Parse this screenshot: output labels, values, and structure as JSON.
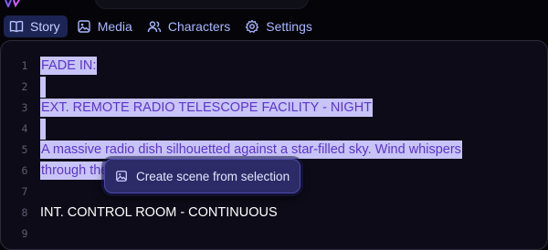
{
  "tabs": [
    {
      "label": "Story",
      "icon": "book-open-icon",
      "active": true
    },
    {
      "label": "Media",
      "icon": "image-icon",
      "active": false
    },
    {
      "label": "Characters",
      "icon": "users-icon",
      "active": false
    },
    {
      "label": "Settings",
      "icon": "gear-icon",
      "active": false
    }
  ],
  "editor": {
    "line_numbers": [
      "1",
      "2",
      "3",
      "4",
      "5",
      "6",
      "7",
      "8",
      "9"
    ],
    "lines": {
      "l1": "FADE IN:",
      "l3": "EXT. REMOTE RADIO TELESCOPE FACILITY - NIGHT",
      "l5": "A massive radio dish silhouetted against a star-filled sky. Wind whispers",
      "l6": "through the",
      "l8": "INT. CONTROL ROOM - CONTINUOUS"
    }
  },
  "popup": {
    "label": "Create scene from selection",
    "icon": "image-icon"
  },
  "colors": {
    "accent_tab_bg": "#1c2453",
    "tab_text": "#aab6ff",
    "selection_bg": "#c8c4f7",
    "selection_text": "#5b35c9",
    "editor_bg": "#0c0b17",
    "button_bg": "#2c2b67"
  }
}
